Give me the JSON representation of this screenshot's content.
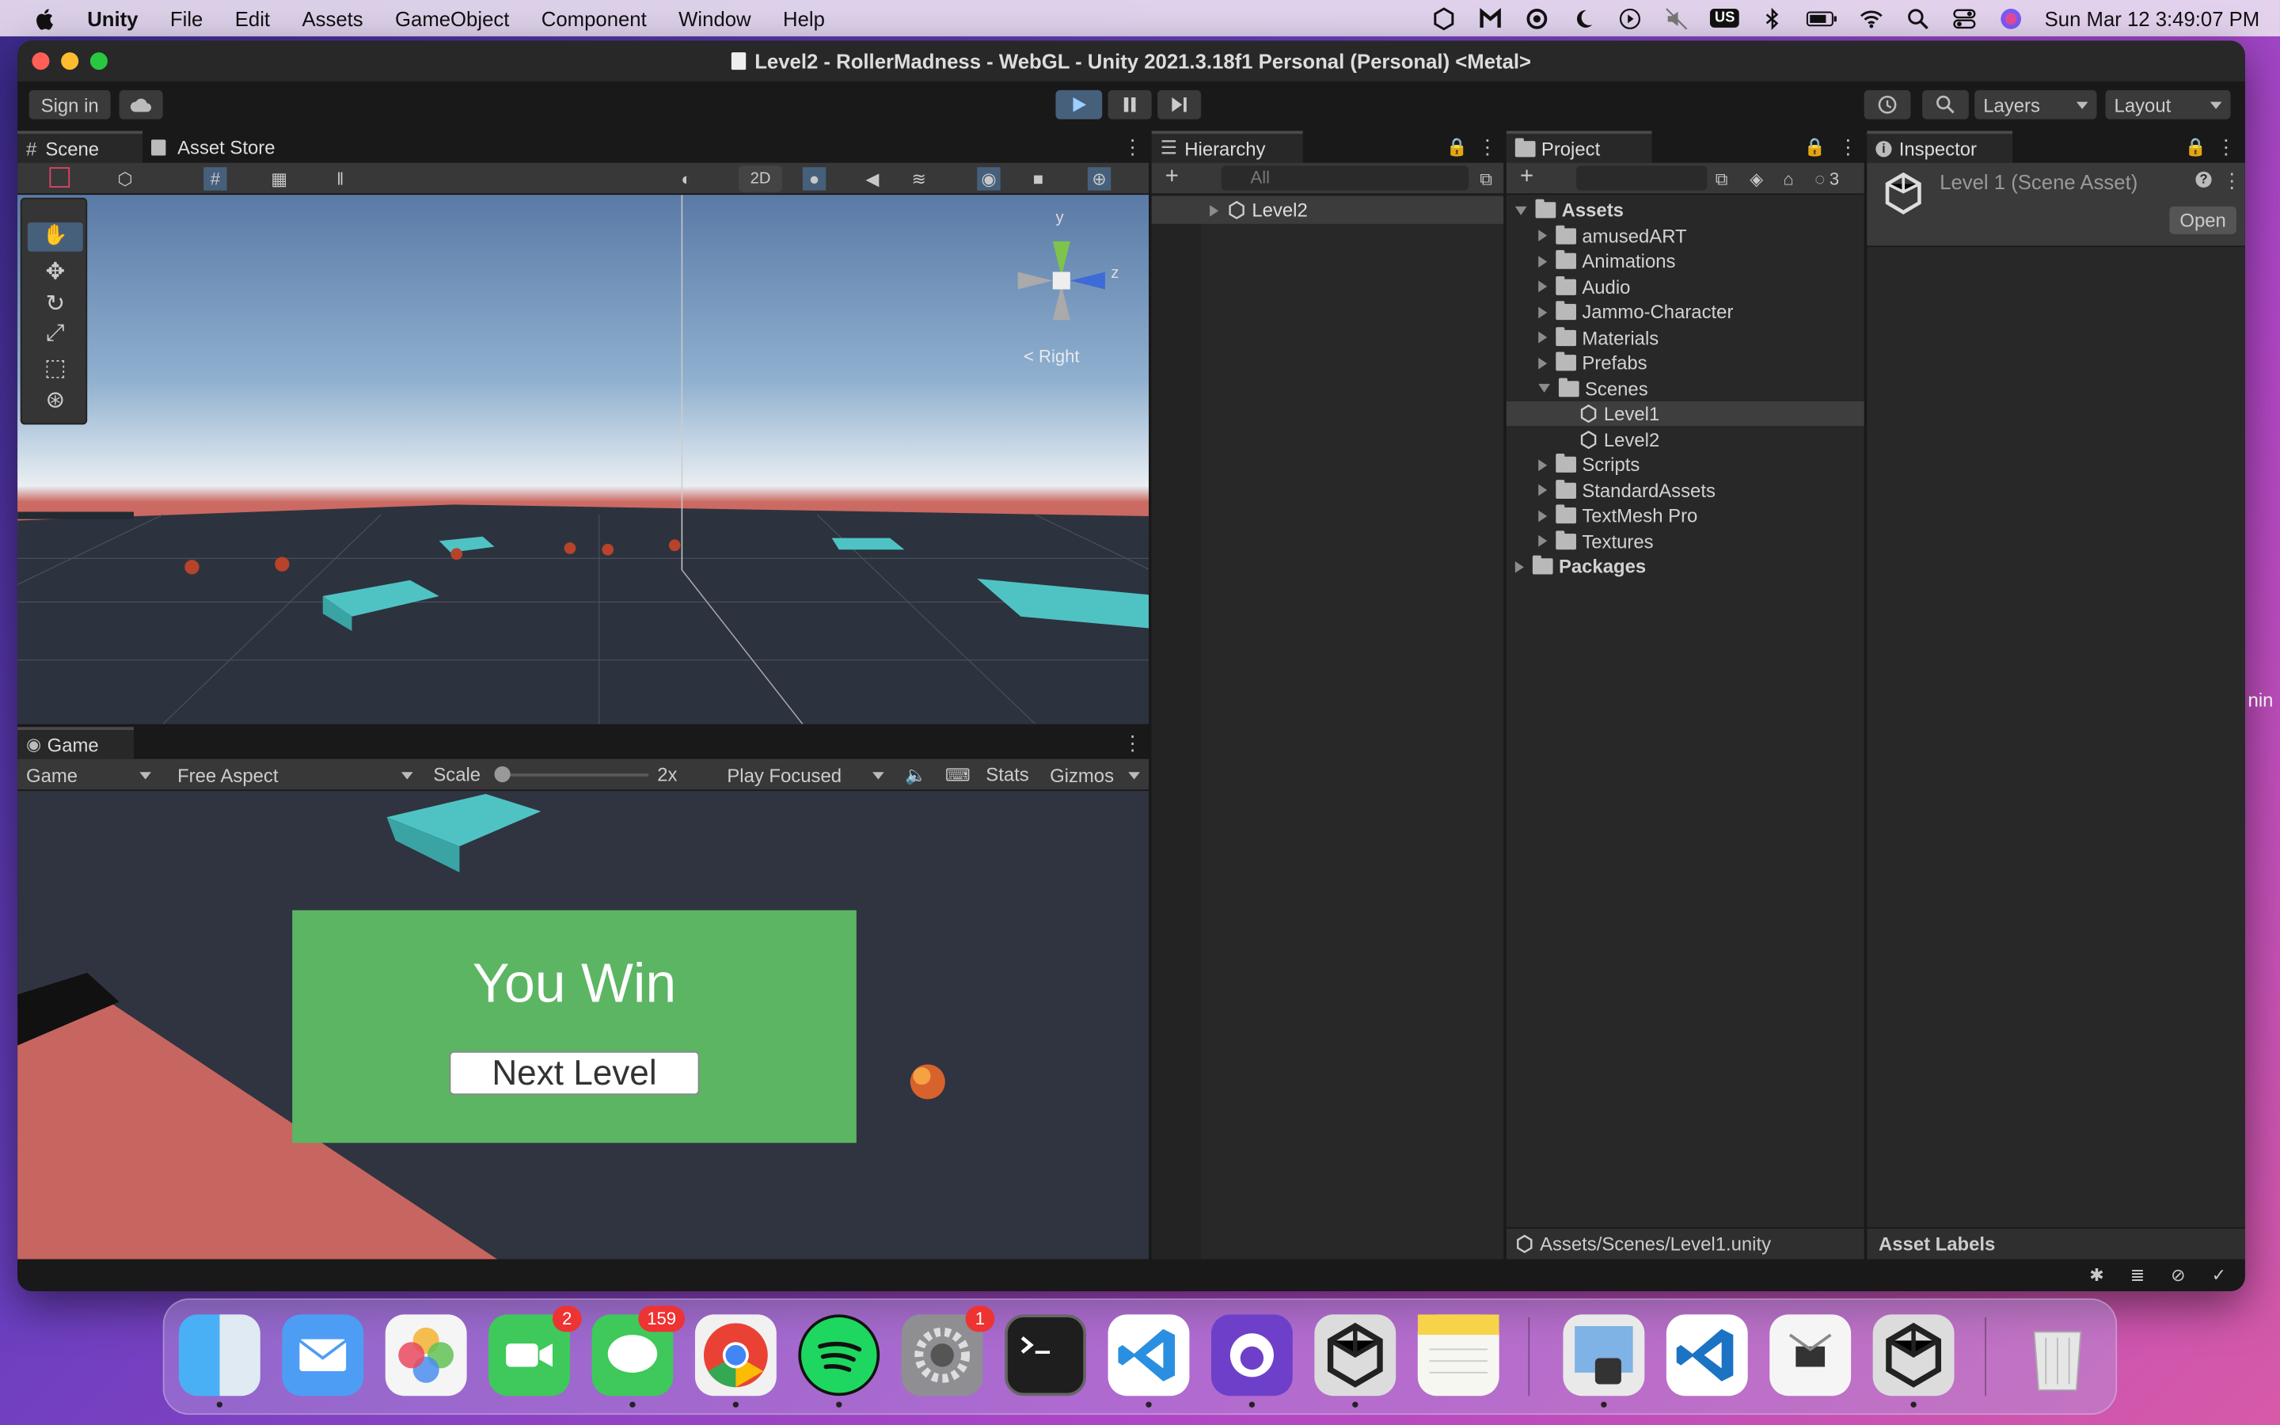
{
  "menubar": {
    "app_name": "Unity",
    "items": [
      "File",
      "Edit",
      "Assets",
      "GameObject",
      "Component",
      "Window",
      "Help"
    ],
    "clock": "Sun Mar 12  3:49:07 PM",
    "input_badge": "US"
  },
  "window": {
    "title": "Level2 - RollerMadness - WebGL - Unity 2021.3.18f1 Personal (Personal) <Metal>"
  },
  "toolbar": {
    "sign_in": "Sign in",
    "layers": "Layers",
    "layout": "Layout"
  },
  "scene_panel": {
    "tabs": [
      "Scene",
      "Asset Store"
    ],
    "mode_2d": "2D",
    "gizmo_label": "< Right",
    "axis_y": "y",
    "axis_z": "z"
  },
  "game_panel": {
    "tab": "Game",
    "display": "Game",
    "aspect": "Free Aspect",
    "scale_label": "Scale",
    "scale_value": "2x",
    "play_mode": "Play Focused",
    "stats": "Stats",
    "gizmos": "Gizmos",
    "win_text": "You Win",
    "next_button": "Next Level",
    "colors": {
      "win_panel": "#5cb562",
      "background": "#2f3440",
      "ground": "#c76660",
      "platform": "#4fc3c4"
    }
  },
  "hierarchy": {
    "tab": "Hierarchy",
    "search_placeholder": "All",
    "scene": "Level2"
  },
  "project": {
    "tab": "Project",
    "hidden_count": "3",
    "assets_root": "Assets",
    "folders": [
      "amusedART",
      "Animations",
      "Audio",
      "Jammo-Character",
      "Materials",
      "Prefabs",
      "Scenes",
      "Scripts",
      "StandardAssets",
      "TextMesh Pro",
      "Textures"
    ],
    "scenes": [
      "Level1",
      "Level2"
    ],
    "packages": "Packages",
    "footer_path": "Assets/Scenes/Level1.unity"
  },
  "inspector": {
    "tab": "Inspector",
    "asset_title": "Level 1 (Scene Asset)",
    "open_button": "Open",
    "footer": "Asset Labels",
    "edge_text": "nin"
  },
  "dock": {
    "apps": [
      {
        "name": "Finder",
        "color": "#3ea0f0"
      },
      {
        "name": "Mail",
        "color": "#4d9df5"
      },
      {
        "name": "Photos",
        "color": "#f5f5f5"
      },
      {
        "name": "FaceTime",
        "color": "#3ec95a",
        "badge": "2"
      },
      {
        "name": "Messages",
        "color": "#3ec95a",
        "badge": "159"
      },
      {
        "name": "Chrome",
        "color": "#f1f1f1"
      },
      {
        "name": "Spotify",
        "color": "#1ed760"
      },
      {
        "name": "System Preferences",
        "color": "#8e8e93",
        "badge": "1"
      },
      {
        "name": "Terminal",
        "color": "#1e1e1e"
      },
      {
        "name": "VS Code",
        "color": "#ffffff"
      },
      {
        "name": "GitHub Desktop",
        "color": "#6e40c9"
      },
      {
        "name": "Unity Hub",
        "color": "#e0e0e0"
      },
      {
        "name": "Notes",
        "color": "#f7d34a"
      },
      {
        "name": "Preview",
        "color": "#e9e9e9"
      },
      {
        "name": "VS Code Insiders",
        "color": "#ffffff"
      },
      {
        "name": "System Information",
        "color": "#f5f5f5"
      },
      {
        "name": "Unity",
        "color": "#e0e0e0"
      },
      {
        "name": "Trash",
        "color": "#d9d9d9"
      }
    ]
  }
}
